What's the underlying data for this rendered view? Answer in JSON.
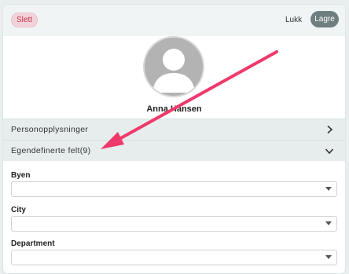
{
  "toolbar": {
    "delete_label": "Slett",
    "close_label": "Lukk",
    "save_label": "Lagre"
  },
  "profile": {
    "name": "Anna Hansen"
  },
  "sections": [
    {
      "label": "Personopplysninger",
      "state": "collapsed"
    },
    {
      "label": "Egendefinerte felt(9)",
      "state": "expanded"
    }
  ],
  "fields": [
    {
      "label": "Byen",
      "value": ""
    },
    {
      "label": "City",
      "value": ""
    },
    {
      "label": "Department",
      "value": ""
    }
  ],
  "colors": {
    "delete": "#c4334e",
    "save_bg": "#6f7f7f",
    "annotation_arrow": "#f0396b"
  },
  "icons": {
    "section_collapsed": "chevron-right-icon",
    "section_expanded": "chevron-down-icon",
    "dropdown": "caret-down-icon"
  }
}
